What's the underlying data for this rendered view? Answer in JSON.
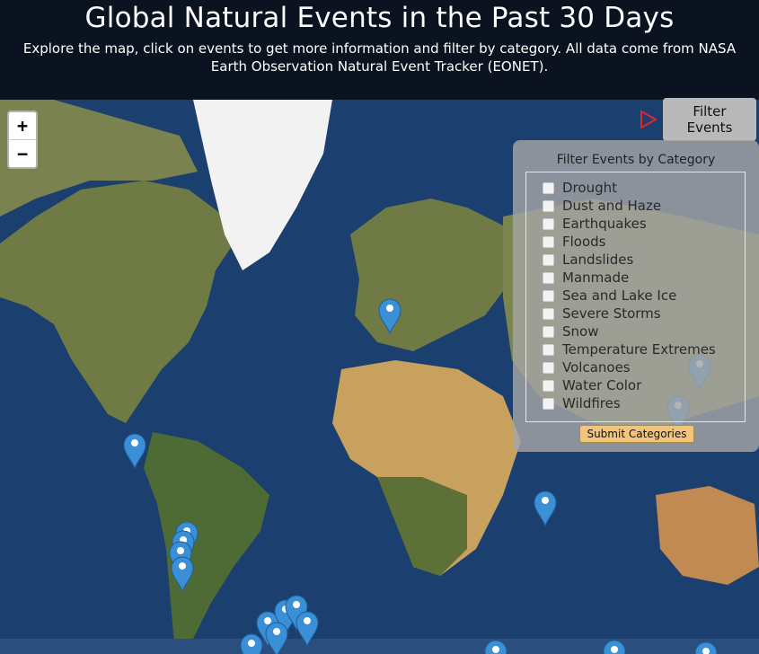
{
  "header": {
    "title": "Global Natural Events in the Past 30 Days",
    "subtitle": "Explore the map, click on events to get more information and filter by category. All data come from NASA Earth Observation Natural Event Tracker (EONET)."
  },
  "map": {
    "zoom_in_label": "+",
    "zoom_out_label": "−",
    "ocean_color": "#1b3f6e",
    "land_color": "#6f7a44",
    "desert_color": "#c8a15f",
    "ice_color": "#f2f2f2",
    "marker_color": "#3a8fd6",
    "markers": [
      {
        "region": "Europe"
      },
      {
        "region": "Central America"
      },
      {
        "region": "Japan"
      },
      {
        "region": "Philippines"
      },
      {
        "region": "Indian Ocean"
      },
      {
        "region": "Chile"
      },
      {
        "region": "Chile"
      },
      {
        "region": "Chile"
      },
      {
        "region": "Chile"
      },
      {
        "region": "Southern Ocean"
      },
      {
        "region": "Southern Ocean"
      },
      {
        "region": "Southern Ocean"
      },
      {
        "region": "Southern Ocean"
      },
      {
        "region": "Southern Ocean"
      },
      {
        "region": "Southern Ocean"
      },
      {
        "region": "Southern Ocean"
      },
      {
        "region": "Southern Ocean"
      },
      {
        "region": "Southern Ocean"
      }
    ]
  },
  "filter": {
    "toggle_label": "Filter Events",
    "panel_title": "Filter Events by Category",
    "categories": [
      "Drought",
      "Dust and Haze",
      "Earthquakes",
      "Floods",
      "Landslides",
      "Manmade",
      "Sea and Lake Ice",
      "Severe Storms",
      "Snow",
      "Temperature Extremes",
      "Volcanoes",
      "Water Color",
      "Wildfires"
    ],
    "submit_label": "Submit Categories",
    "toggle_arrow_color": "#e2252b"
  }
}
